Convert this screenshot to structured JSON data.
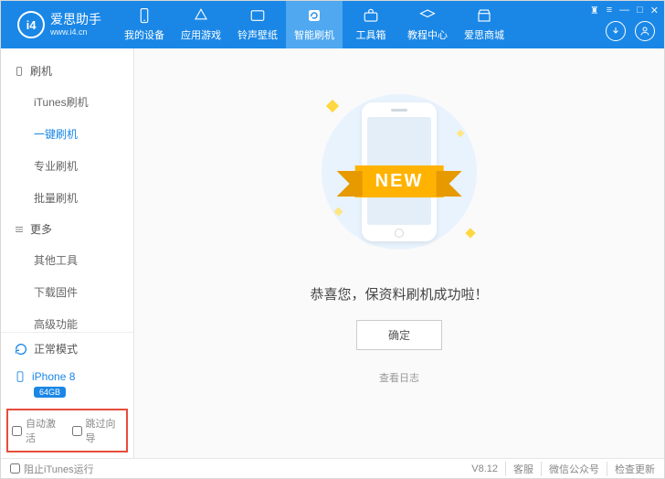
{
  "brand": {
    "title": "爱思助手",
    "subtitle": "www.i4.cn",
    "logo_text": "i4"
  },
  "tabs": [
    {
      "label": "我的设备"
    },
    {
      "label": "应用游戏"
    },
    {
      "label": "铃声壁纸"
    },
    {
      "label": "智能刷机"
    },
    {
      "label": "工具箱"
    },
    {
      "label": "教程中心"
    },
    {
      "label": "爱思商城"
    }
  ],
  "sidebar": {
    "section1": {
      "title": "刷机",
      "items": [
        "iTunes刷机",
        "一键刷机",
        "专业刷机",
        "批量刷机"
      ]
    },
    "section2": {
      "title": "更多",
      "items": [
        "其他工具",
        "下载固件",
        "高级功能"
      ]
    },
    "mode": "正常模式",
    "device": {
      "name": "iPhone 8",
      "storage": "64GB"
    },
    "checks": {
      "auto_activate": "自动激活",
      "skip_guide": "跳过向导"
    }
  },
  "main": {
    "ribbon": "NEW",
    "message": "恭喜您，保资料刷机成功啦！",
    "ok": "确定",
    "view_log": "查看日志"
  },
  "footer": {
    "block_itunes": "阻止iTunes运行",
    "version": "V8.12",
    "support": "客服",
    "wechat": "微信公众号",
    "update": "检查更新"
  }
}
